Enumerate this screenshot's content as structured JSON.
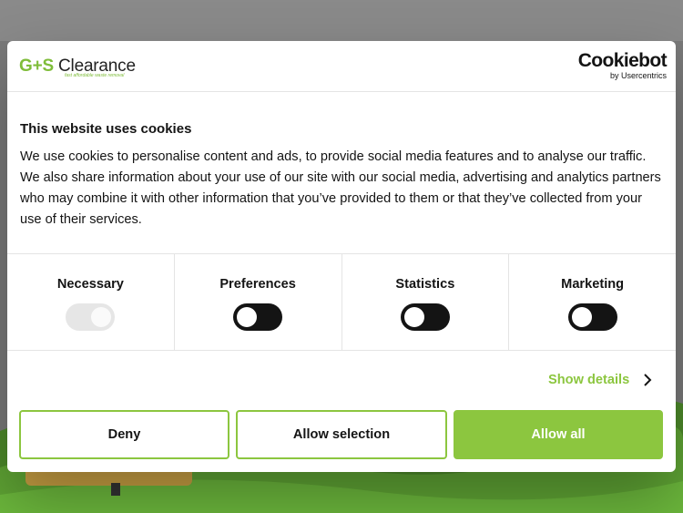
{
  "brand": {
    "name_prefix": "G+S",
    "name_rest": " Clearance",
    "tagline": "fast affordable waste removal"
  },
  "cookiebot": {
    "logo_text": "Cookiebot",
    "logo_sub": "by Usercentrics"
  },
  "content": {
    "title": "This website uses cookies",
    "text": "We use cookies to personalise content and ads, to provide social media features and to analyse our traffic. We also share information about your use of our site with our social media, advertising and analytics partners who may combine it with other information that you’ve provided to them or that they’ve collected from your use of their services."
  },
  "categories": [
    {
      "label": "Necessary",
      "enabled": true,
      "disabled": true
    },
    {
      "label": "Preferences",
      "enabled": false,
      "disabled": false
    },
    {
      "label": "Statistics",
      "enabled": false,
      "disabled": false
    },
    {
      "label": "Marketing",
      "enabled": false,
      "disabled": false
    }
  ],
  "show_details": {
    "label": "Show details",
    "icon": "chevron-right-icon"
  },
  "buttons": {
    "deny": "Deny",
    "allow_selection": "Allow selection",
    "allow_all": "Allow all"
  },
  "colors": {
    "accent": "#8cc63f",
    "text": "#141414",
    "toggle_off": "#141414"
  }
}
